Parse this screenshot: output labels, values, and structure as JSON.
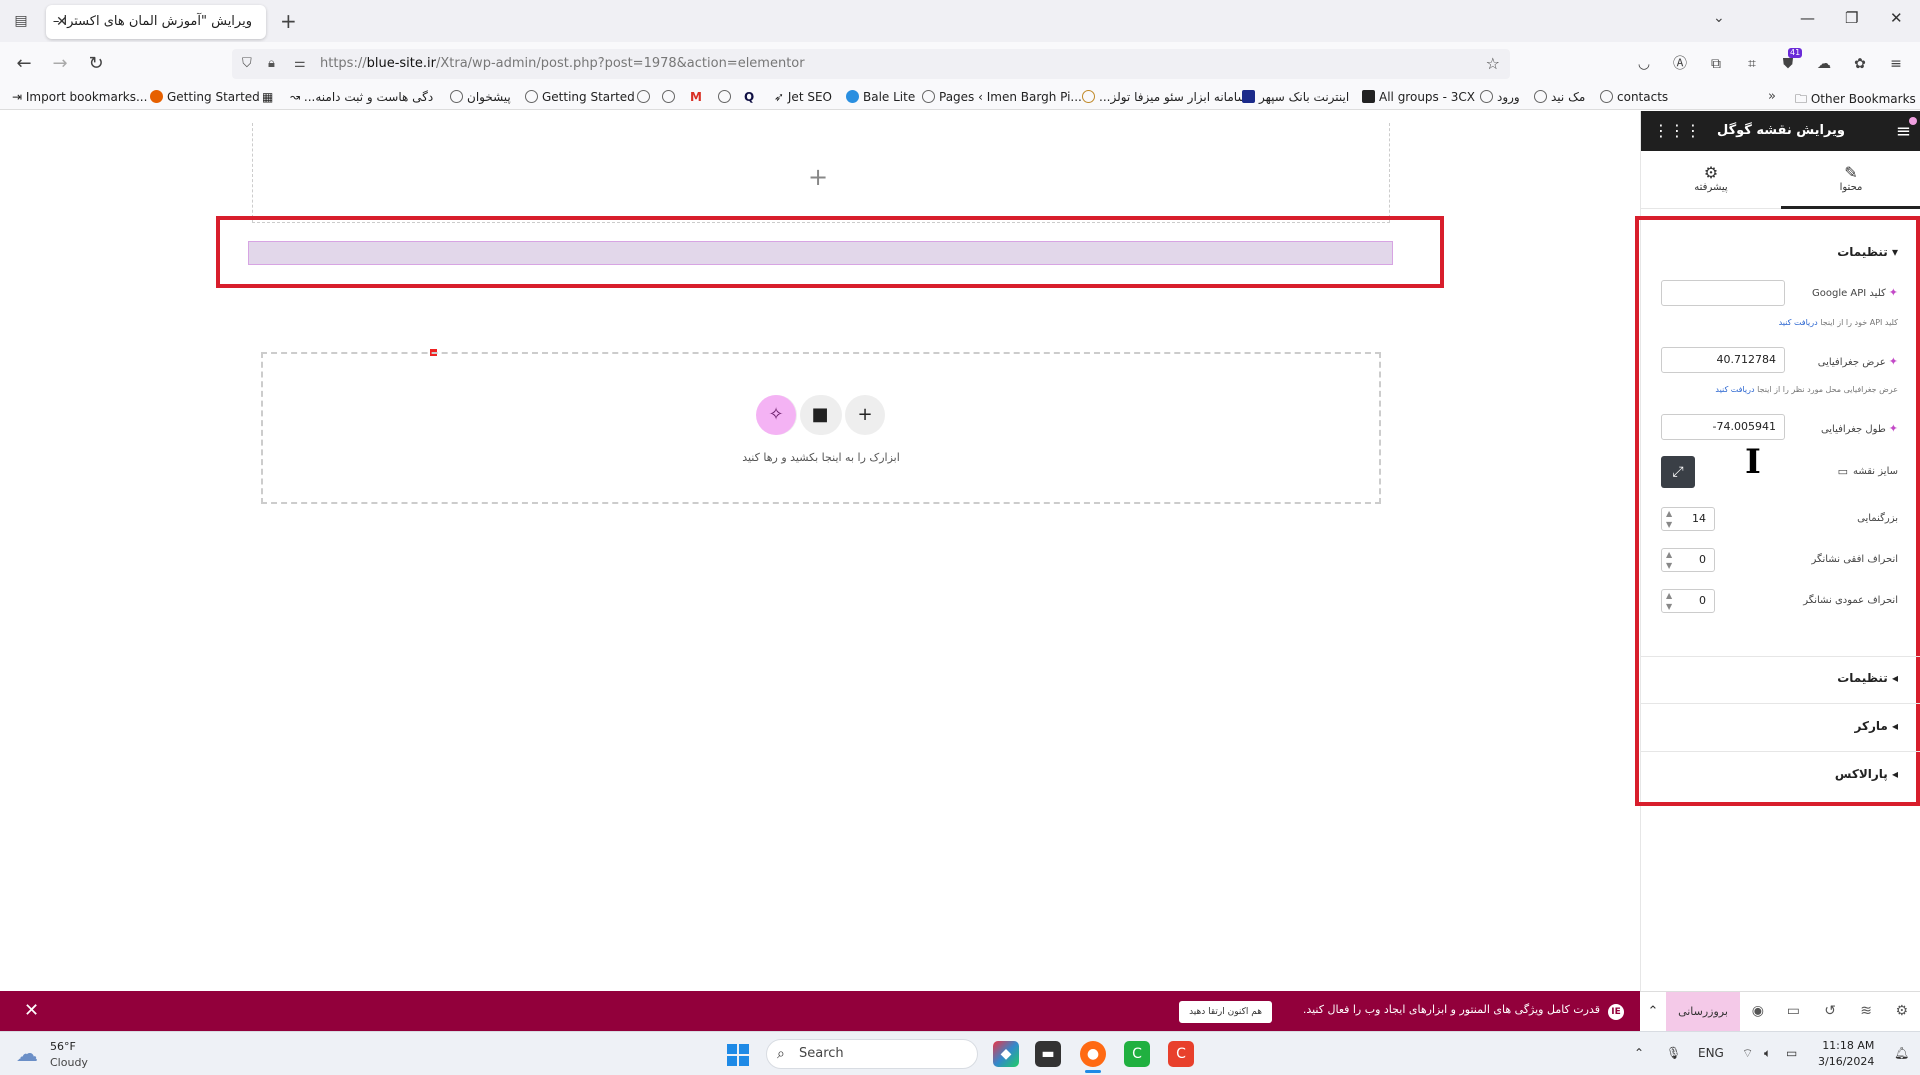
{
  "browser": {
    "tab_title": "ویرایش \"آموزش المان های اکسترا – ...",
    "url_prefix": "https://",
    "url_host": "blue-site.ir",
    "url_path": "/Xtra/wp-admin/post.php?post=1978&action=elementor",
    "extension_badge": "41",
    "bookmarks": [
      "Import bookmarks...",
      "Getting Started",
      "...دگی هاست و ثبت دامنه",
      "پیشخوان",
      "Getting Started",
      "Jet SEO",
      "Bale Lite",
      "Pages ‹ Imen Bargh Pi...",
      "...سامانه ابزار سئو میزفا تولز",
      "اینترنت بانک سپهر",
      "All groups - 3CX",
      "ورود",
      "مک نید",
      "contacts"
    ],
    "other_bookmarks": "Other Bookmarks"
  },
  "canvas": {
    "drop_text": "ابزارک را به اینجا بکشید و رها کنید",
    "add_icon": "plus-icon"
  },
  "panel": {
    "title": "ویرایش نقشه گوگل",
    "tabs": [
      {
        "label": "محتوا",
        "icon": "pencil-icon",
        "active": true
      },
      {
        "label": "پیشرفته",
        "icon": "gear-icon",
        "active": false
      }
    ],
    "section_open": "تنظیمات",
    "api_key_label": "کلید Google API",
    "api_key_value": "",
    "api_key_hint": "کلید API خود را از اینجا",
    "api_key_hint_link": "دریافت کنید",
    "lat_label": "عرض جغرافیایی",
    "lat_value": "40.712784",
    "lat_hint": "عرض جغرافیایی محل مورد نظر را از اینجا",
    "lat_hint_link": "دریافت کنید",
    "lng_label": "طول جغرافیایی",
    "lng_value": "-74.005941",
    "map_size_label": "سایز نقشه",
    "zoom_label": "بزرگنمایی",
    "zoom_value": "14",
    "offset_x_label": "انحراف افقی نشانگر",
    "offset_x_value": "0",
    "offset_y_label": "انحراف عمودی نشانگر",
    "offset_y_value": "0",
    "collapsed_sections": [
      "تنظیمات",
      "مارکر",
      "پارالاکس"
    ]
  },
  "elementor_bar": {
    "publish_label": "بروزرسانی",
    "promo_text": "قدرت کامل ویژگی های المنتور و ابزارهای ایجاد وب را فعال کنید.",
    "promo_button": "هم اکنون ارتقا دهید"
  },
  "taskbar": {
    "weather_temp": "56°F",
    "weather_cond": "Cloudy",
    "search_placeholder": "Search",
    "language": "ENG",
    "time": "11:18 AM",
    "date": "3/16/2024"
  },
  "colors": {
    "highlight_red": "#d81e2c",
    "elementor_maroon": "#92003b",
    "panel_header": "#1f1f1f"
  }
}
